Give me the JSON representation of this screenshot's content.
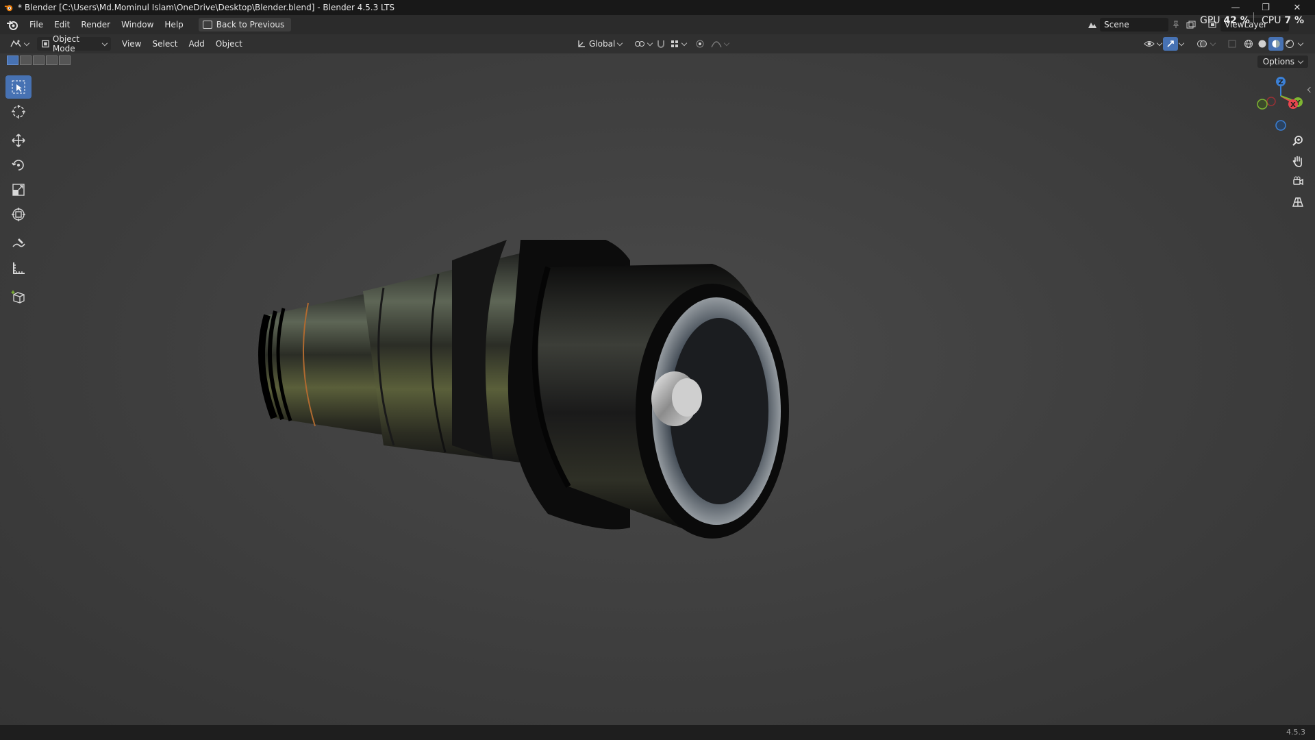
{
  "window": {
    "title": "* Blender [C:\\Users\\Md.Mominul Islam\\OneDrive\\Desktop\\Blender.blend] - Blender 4.5.3 LTS",
    "minimize": "—",
    "restore": "❐",
    "close": "✕"
  },
  "menubar": {
    "items": [
      "File",
      "Edit",
      "Render",
      "Window",
      "Help"
    ],
    "back_button": "Back to Previous",
    "scene": "Scene",
    "view_layer": "ViewLayer",
    "gpu_label": "GPU",
    "gpu_value": "42 %",
    "cpu_label": "CPU",
    "cpu_value": "7 %"
  },
  "viewport_header": {
    "mode": "Object Mode",
    "menus": [
      "View",
      "Select",
      "Add",
      "Object"
    ],
    "transform_orientation": "Global"
  },
  "viewport": {
    "options_label": "Options",
    "gizmo": {
      "z": "Z",
      "x": "X",
      "y": "Y"
    }
  },
  "toolbar": {
    "tools": [
      "select-box",
      "cursor",
      "move",
      "rotate",
      "scale",
      "transform",
      "annotate",
      "measure",
      "add-cube"
    ]
  },
  "statusbar": {
    "version": "4.5.3"
  },
  "colors": {
    "accent": "#4772b3",
    "x_axis": "#e8464e",
    "y_axis": "#7fb632",
    "z_axis": "#3b80d6"
  }
}
